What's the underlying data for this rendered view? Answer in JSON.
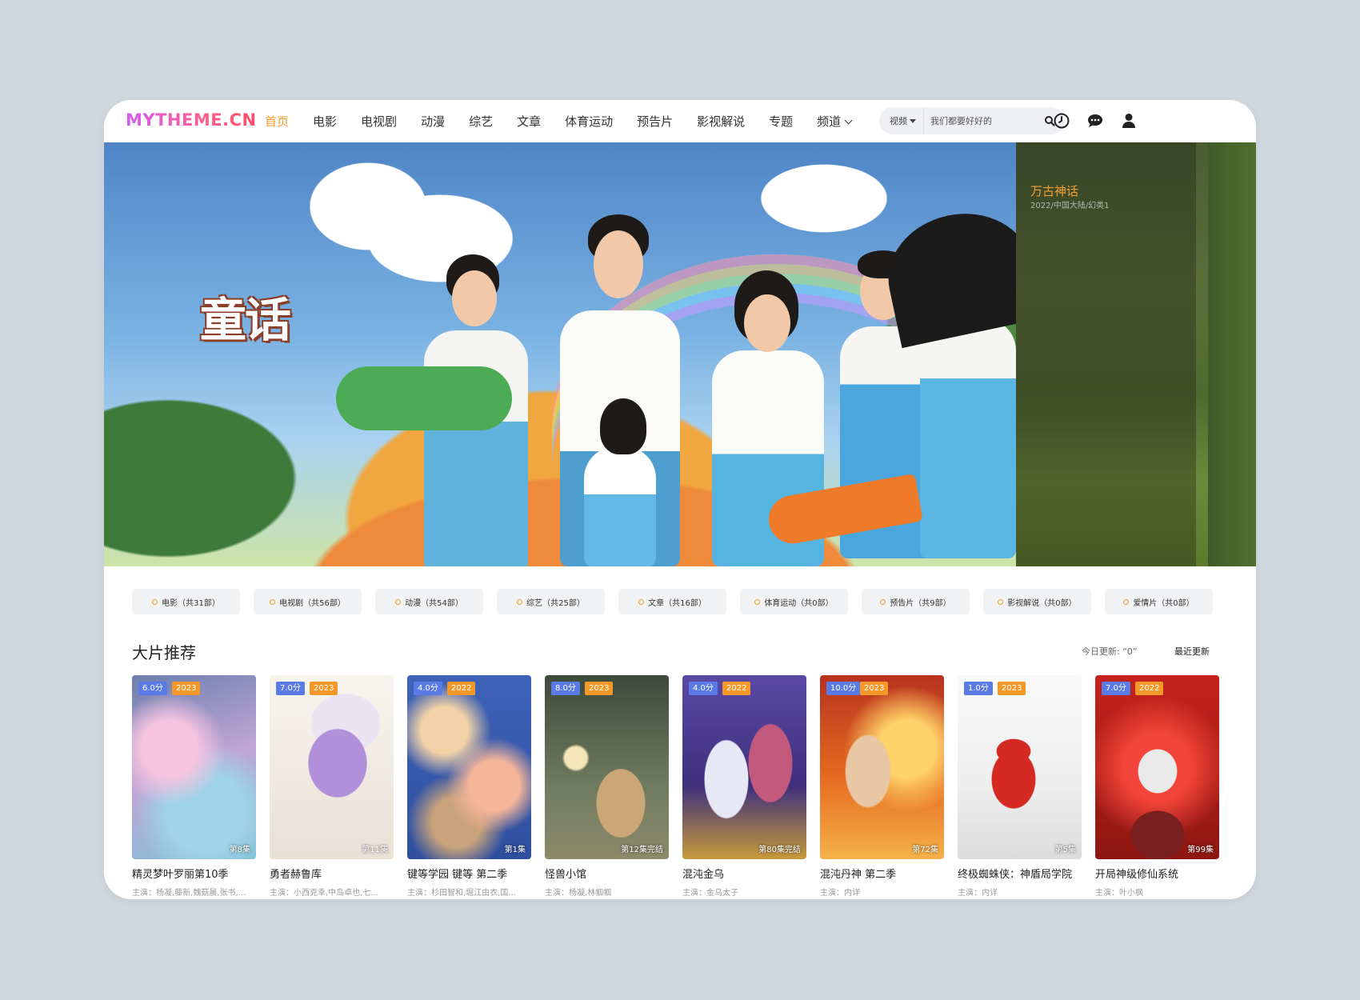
{
  "header": {
    "logo": "MYTHEME.CN",
    "nav": [
      "首页",
      "电影",
      "电视剧",
      "动漫",
      "综艺",
      "文章",
      "体育运动",
      "预告片",
      "影视解说",
      "专题",
      "频道"
    ],
    "search": {
      "category": "视频",
      "placeholder": "我们都要好好的"
    },
    "icons": [
      "clock-icon",
      "chat-icon",
      "user-icon"
    ]
  },
  "banner": {
    "show_logo": "童话",
    "featured_title": "万古神话",
    "featured_meta": "2022/中国大陆/幻类1"
  },
  "categories": [
    "电影（共31部）",
    "电视剧（共56部）",
    "动漫（共54部）",
    "综艺（共25部）",
    "文章（共16部）",
    "体育运动（共0部）",
    "预告片（共9部）",
    "影视解说（共0部）",
    "爱情片（共0部）"
  ],
  "section": {
    "title": "大片推荐",
    "today_label": "今日更新: “0”",
    "recent_label": "最近更新"
  },
  "cards": [
    {
      "score": "6.0分",
      "year": "2023",
      "ep": "第8集",
      "title": "精灵梦叶罗丽第10季",
      "cast": "主演：杨凝,藤新,魏菇晨,张书,..."
    },
    {
      "score": "7.0分",
      "year": "2023",
      "ep": "第11集",
      "title": "勇者赫鲁库",
      "cast": "主演：小西克幸,中岛卓也,七..."
    },
    {
      "score": "4.0分",
      "year": "2022",
      "ep": "第1集",
      "title": "键等学园 键等 第二季",
      "cast": "主演：杉田智和,堀江由衣,国..."
    },
    {
      "score": "8.0分",
      "year": "2023",
      "ep": "第12集完结",
      "title": "怪兽小馆",
      "cast": "主演：杨凝,林帼帼"
    },
    {
      "score": "4.0分",
      "year": "2022",
      "ep": "第80集完结",
      "title": "混沌金乌",
      "cast": "主演：金乌太子"
    },
    {
      "score": "10.0分",
      "year": "2023",
      "ep": "第72集",
      "title": "混沌丹神 第二季",
      "cast": "主演：内详"
    },
    {
      "score": "1.0分",
      "year": "2023",
      "ep": "第5集",
      "title": "终极蜘蛛侠：神盾局学院",
      "cast": "主演：内详"
    },
    {
      "score": "7.0分",
      "year": "2022",
      "ep": "第99集",
      "title": "开局神级修仙系统",
      "cast": "主演：叶小枫"
    }
  ],
  "colors": {
    "accent": "#f39a27",
    "score_badge": "#5a7be6",
    "year_badge": "#f4982a"
  }
}
